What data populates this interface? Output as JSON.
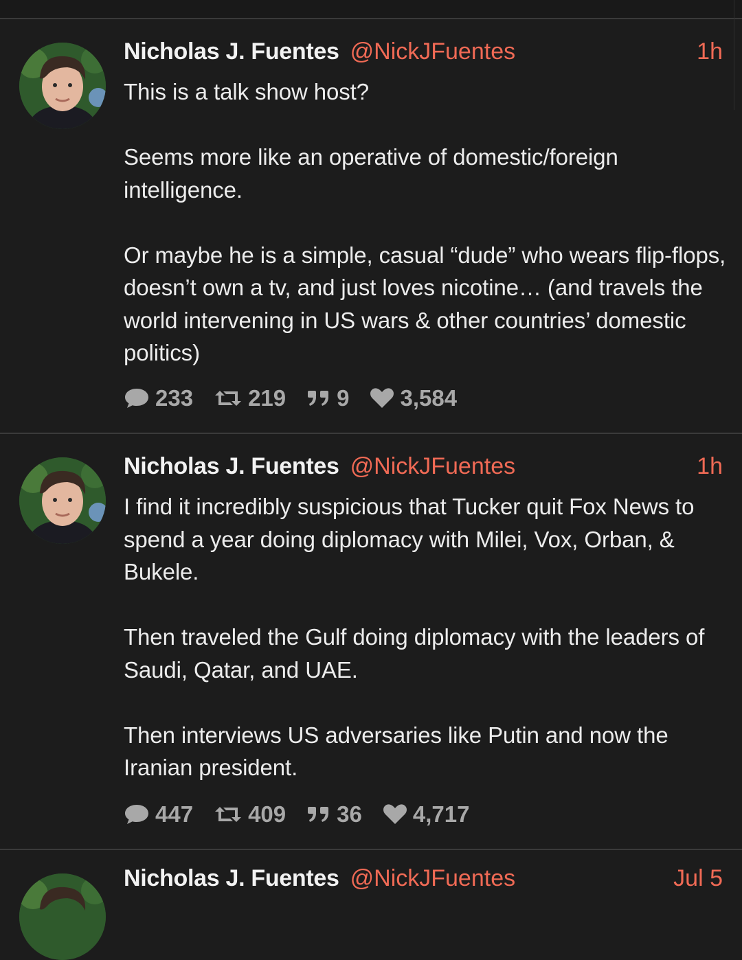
{
  "colors": {
    "background": "#1c1c1c",
    "divider": "#3a3a3a",
    "text": "#ececec",
    "accent": "#f06a55",
    "muted": "#a8a8a8"
  },
  "posts": [
    {
      "author_name": "Nicholas J. Fuentes",
      "handle": "@NickJFuentes",
      "time": "1h",
      "paragraphs": [
        "This is a talk show host?",
        "Seems more like an operative of domestic/foreign intelligence.",
        "Or maybe he is a simple, casual “dude” who wears flip-flops, doesn’t own a tv, and just loves nicotine… (and travels the world intervening in US wars & other countries’ domestic politics)"
      ],
      "stats": {
        "replies": "233",
        "reposts": "219",
        "quotes": "9",
        "likes": "3,584"
      }
    },
    {
      "author_name": "Nicholas J. Fuentes",
      "handle": "@NickJFuentes",
      "time": "1h",
      "paragraphs": [
        "I find it incredibly suspicious that Tucker quit Fox News to spend a year doing diplomacy with Milei, Vox, Orban, & Bukele.",
        "Then traveled the Gulf doing diplomacy with the leaders of Saudi, Qatar, and UAE.",
        "Then interviews US adversaries like Putin and now the Iranian president."
      ],
      "stats": {
        "replies": "447",
        "reposts": "409",
        "quotes": "36",
        "likes": "4,717"
      }
    },
    {
      "author_name": "Nicholas J. Fuentes",
      "handle": "@NickJFuentes",
      "time": "Jul 5"
    }
  ],
  "icons": {
    "avatar": "profile-photo",
    "reply": "speech-bubble-icon",
    "repost": "retweet-arrows-icon",
    "quote": "quote-marks-icon",
    "like": "heart-icon"
  }
}
